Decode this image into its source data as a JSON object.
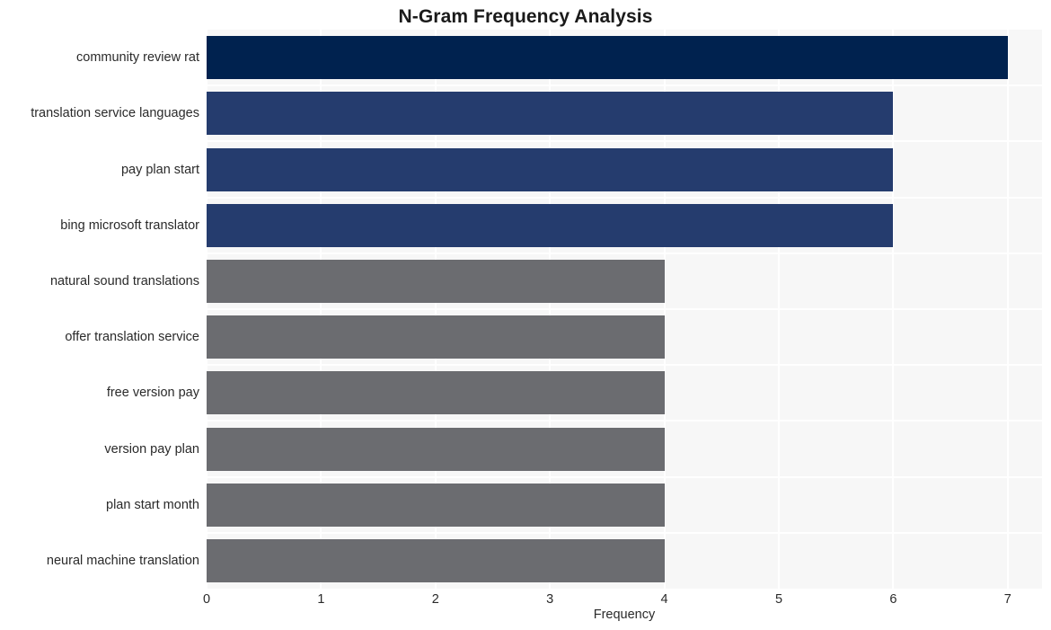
{
  "chart_data": {
    "type": "bar",
    "orientation": "horizontal",
    "title": "N-Gram Frequency Analysis",
    "xlabel": "Frequency",
    "ylabel": "",
    "xlim": [
      0,
      7.3
    ],
    "xticks": [
      "0",
      "1",
      "2",
      "3",
      "4",
      "5",
      "6",
      "7"
    ],
    "xtick_values": [
      0,
      1,
      2,
      3,
      4,
      5,
      6,
      7
    ],
    "grid": true,
    "legend": false,
    "categories": [
      "community review rat",
      "translation service languages",
      "pay plan start",
      "bing microsoft translator",
      "natural sound translations",
      "offer translation service",
      "free version pay",
      "version pay plan",
      "plan start month",
      "neural machine translation"
    ],
    "values": [
      7,
      6,
      6,
      6,
      4,
      4,
      4,
      4,
      4,
      4
    ],
    "bar_colors": [
      "#00224f",
      "#253c6e",
      "#253c6e",
      "#253c6e",
      "#6b6c70",
      "#6b6c70",
      "#6b6c70",
      "#6b6c70",
      "#6b6c70",
      "#6b6c70"
    ],
    "plot_background": "#f7f7f7",
    "grid_color": "#ffffff",
    "figure_background": "#ffffff",
    "text_color": "#2a2a2a",
    "title_color": "#1a1a1a"
  }
}
